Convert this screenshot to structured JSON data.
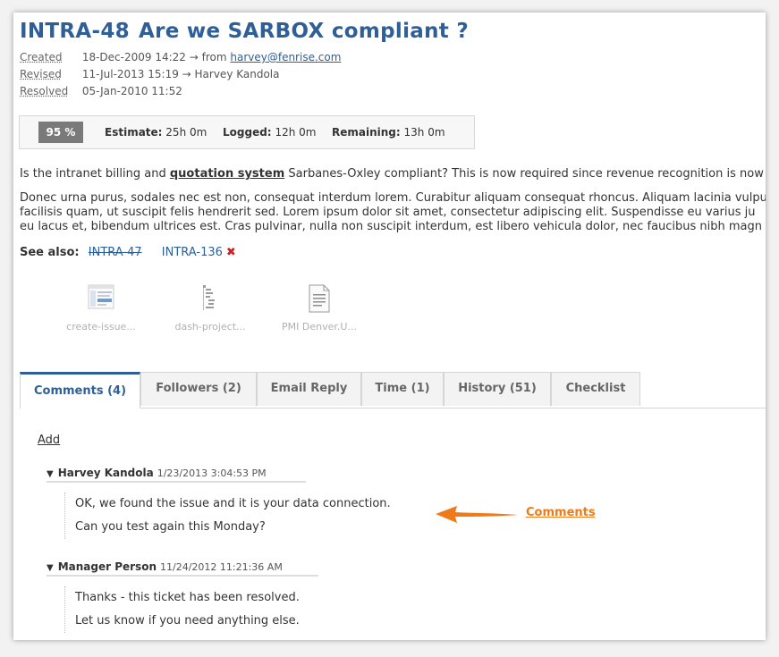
{
  "issue": {
    "key": "INTRA-48",
    "title": "Are we SARBOX compliant ?"
  },
  "meta": {
    "created_label": "Created",
    "created_value": "18-Dec-2009 14:22 → from",
    "created_email": "harvey@fenrise.com",
    "revised_label": "Revised",
    "revised_value": "11-Jul-2013 15:19 → Harvey Kandola",
    "resolved_label": "Resolved",
    "resolved_value": "05-Jan-2010 11:52"
  },
  "progress": {
    "percent_label": "95 %",
    "estimate_label": "Estimate:",
    "estimate_value": "25h 0m",
    "logged_label": "Logged:",
    "logged_value": "12h 0m",
    "remaining_label": "Remaining:",
    "remaining_value": "13h 0m"
  },
  "description": {
    "line1_pre": "Is the intranet billing and ",
    "line1_keyword": "quotation system",
    "line1_post": " Sarbanes-Oxley compliant? This is now required since revenue recognition is now",
    "para2_line1": "Donec urna purus, sodales nec est non, consequat interdum lorem. Curabitur aliquam consequat rhoncus. Aliquam lacinia vulpu",
    "para2_line2": "facilisis quam, ut suscipit felis hendrerit sed. Lorem ipsum dolor sit amet, consectetur adipiscing elit. Suspendisse eu varius ju",
    "para2_line3": "eu lacus et, bibendum ultrices est. Cras pulvinar, nulla non suscipit interdum, est libero vehicula dolor, nec faucibus nibh magn"
  },
  "see_also": {
    "label": "See also:",
    "links": [
      {
        "text": "INTRA-47",
        "struck": true
      },
      {
        "text": "INTRA-136",
        "struck": false
      }
    ],
    "remove_glyph": "✖"
  },
  "attachments": [
    {
      "caption": "create-issue...",
      "icon": "screenshot-image-icon"
    },
    {
      "caption": "dash-project...",
      "icon": "tree-document-icon"
    },
    {
      "caption": "PMI Denver.U...",
      "icon": "text-document-icon"
    }
  ],
  "tabs": [
    {
      "label": "Comments (4)",
      "active": true
    },
    {
      "label": "Followers (2)",
      "active": false
    },
    {
      "label": "Email Reply",
      "active": false
    },
    {
      "label": "Time (1)",
      "active": false
    },
    {
      "label": "History (51)",
      "active": false
    },
    {
      "label": "Checklist",
      "active": false
    }
  ],
  "comments_panel": {
    "add_label": "Add",
    "comments": [
      {
        "author": "Harvey Kandola",
        "date": "1/23/2013 3:04:53 PM",
        "lines": [
          "OK, we found the issue and it is your data connection.",
          "Can you test again this Monday?"
        ]
      },
      {
        "author": "Manager Person",
        "date": "11/24/2012 11:21:36 AM",
        "lines": [
          "Thanks - this ticket has been resolved.",
          "Let us know if you need anything else."
        ]
      }
    ]
  },
  "annotation": {
    "label": "Comments",
    "color": "#ef7a1a"
  },
  "colors": {
    "title_blue": "#2f5f97",
    "remove_red": "#cc2222",
    "progress_gray": "#7a7a7a"
  }
}
